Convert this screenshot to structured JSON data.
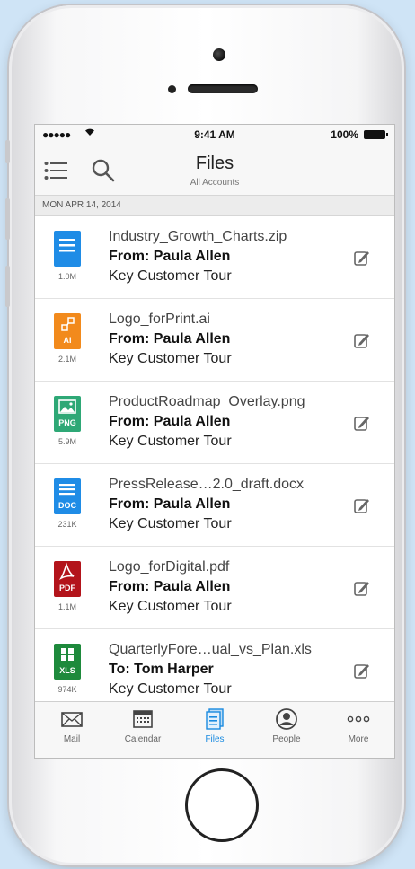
{
  "status": {
    "signal": "●●●●●",
    "time": "9:41 AM",
    "battery": "100%"
  },
  "nav": {
    "title": "Files",
    "subtitle": "All Accounts"
  },
  "date_header": "MON APR 14, 2014",
  "files": [
    {
      "name": "Industry_Growth_Charts.zip",
      "from": "From: Paula Allen",
      "group": "Key Customer Tour",
      "size": "1.0M",
      "type_tag": "",
      "color": "#1f8ce6",
      "icon": "zip-file-icon"
    },
    {
      "name": "Logo_forPrint.ai",
      "from": "From: Paula Allen",
      "group": "Key Customer Tour",
      "size": "2.1M",
      "type_tag": "AI",
      "color": "#f28a1c",
      "icon": "ai-file-icon"
    },
    {
      "name": "ProductRoadmap_Overlay.png",
      "from": "From: Paula Allen",
      "group": "Key Customer Tour",
      "size": "5.9M",
      "type_tag": "PNG",
      "color": "#2ea876",
      "icon": "png-file-icon"
    },
    {
      "name": "PressRelease…2.0_draft.docx",
      "from": "From: Paula Allen",
      "group": "Key Customer Tour",
      "size": "231K",
      "type_tag": "DOC",
      "color": "#1f8ce6",
      "icon": "doc-file-icon"
    },
    {
      "name": "Logo_forDigital.pdf",
      "from": "From: Paula Allen",
      "group": "Key Customer Tour",
      "size": "1.1M",
      "type_tag": "PDF",
      "color": "#b3141b",
      "icon": "pdf-file-icon"
    },
    {
      "name": "QuarterlyFore…ual_vs_Plan.xls",
      "from": "To: Tom Harper",
      "group": "Key Customer Tour",
      "size": "974K",
      "type_tag": "XLS",
      "color": "#1e8a3c",
      "icon": "xls-file-icon"
    }
  ],
  "tabs": [
    {
      "label": "Mail",
      "icon": "mail-icon",
      "active": false
    },
    {
      "label": "Calendar",
      "icon": "calendar-icon",
      "active": false
    },
    {
      "label": "Files",
      "icon": "files-icon",
      "active": true
    },
    {
      "label": "People",
      "icon": "people-icon",
      "active": false
    },
    {
      "label": "More",
      "icon": "more-icon",
      "active": false
    }
  ],
  "colors": {
    "accent": "#1a8be0",
    "background": "#cfe4f6"
  }
}
